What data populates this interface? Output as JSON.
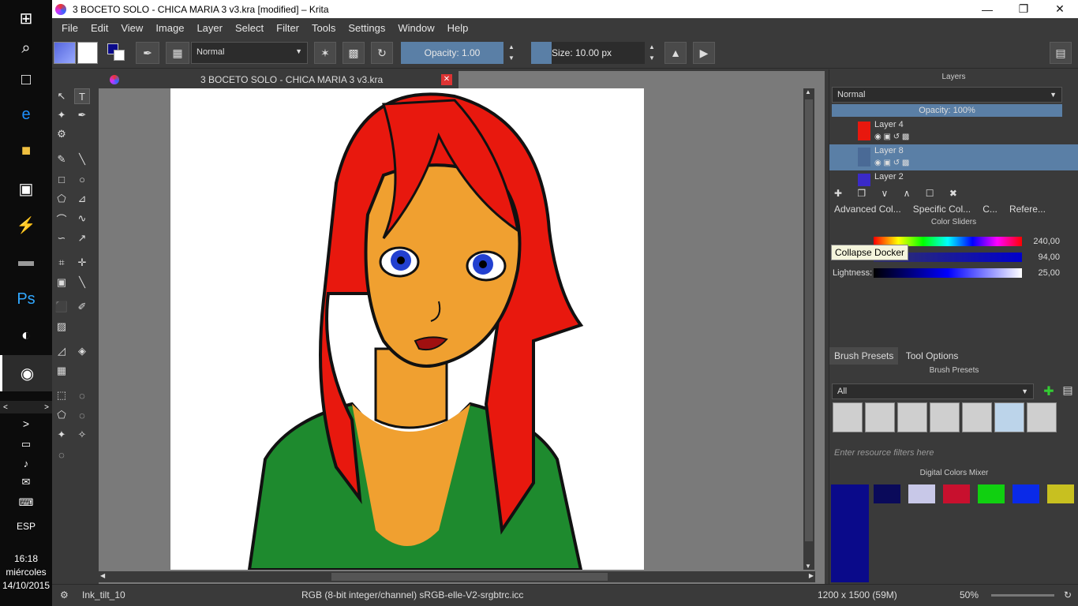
{
  "window": {
    "title": "3 BOCETO SOLO - CHICA MARIA 3 v3.kra [modified] – Krita"
  },
  "menu": [
    "File",
    "Edit",
    "View",
    "Image",
    "Layer",
    "Select",
    "Filter",
    "Tools",
    "Settings",
    "Window",
    "Help"
  ],
  "toolbar": {
    "blend_mode": "Normal",
    "opacity_label": "Opacity:  1.00",
    "opacity_value": 1.0,
    "size_label": "Size:  10.00 px",
    "size_value": 10.0
  },
  "document_tab": {
    "name": "3 BOCETO SOLO - CHICA MARIA 3 v3.kra"
  },
  "layers": {
    "title": "Layers",
    "blend_mode": "Normal",
    "opacity_label": "Opacity:  100%",
    "items": [
      {
        "name": "Layer 4",
        "selected": false
      },
      {
        "name": "Layer 8",
        "selected": true
      },
      {
        "name": "Layer 2",
        "selected": false
      }
    ],
    "tabs": [
      "Advanced Col...",
      "Specific Col...",
      "C...",
      "Refere..."
    ]
  },
  "color_sliders": {
    "title": "Color Sliders",
    "tooltip": "Collapse Docker",
    "rows": [
      {
        "label": "",
        "value": "240,00"
      },
      {
        "label": "Saturation:",
        "value": "94,00"
      },
      {
        "label": "Lightness:",
        "value": "25,00"
      }
    ]
  },
  "brush_panel": {
    "tabs": [
      "Brush Presets",
      "Tool Options"
    ],
    "title": "Brush Presets",
    "filter": "All",
    "search_placeholder": "Enter resource filters here"
  },
  "digital_mixer": {
    "title": "Digital Colors Mixer",
    "current_color": "#0a0a8a",
    "swatches": [
      "#0a0a5a",
      "#c8c8e8",
      "#c8102e",
      "#10d010",
      "#0a2ae8",
      "#c8c020"
    ],
    "bottom_swatches": [
      "#000000",
      "#ffffff",
      "#e81010",
      "#10e010",
      "#1028e8",
      "#f0f010"
    ]
  },
  "statusbar": {
    "brush": "Ink_tilt_10",
    "color_profile": "RGB (8-bit integer/channel)  sRGB-elle-V2-srgbtrc.icc",
    "dimensions": "1200 x 1500 (59M)",
    "zoom": "50%"
  },
  "taskbar": {
    "language": "ESP",
    "time": "16:18",
    "day": "miércoles",
    "date": "14/10/2015"
  }
}
